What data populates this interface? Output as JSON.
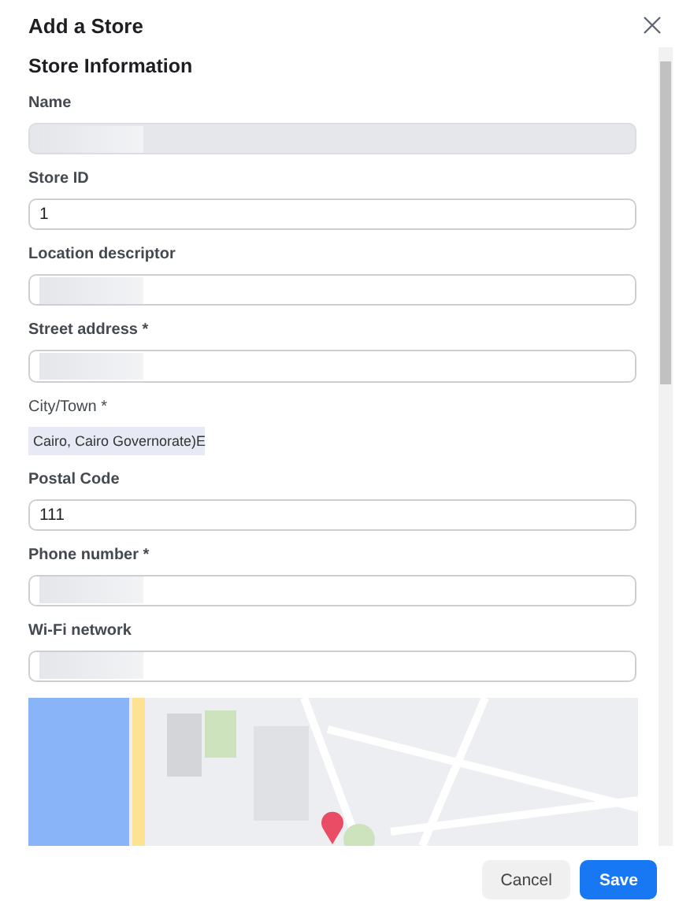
{
  "dialog": {
    "title": "Add a Store"
  },
  "section": {
    "title": "Store Information"
  },
  "fields": [
    {
      "kind": "text",
      "label": "Name",
      "disabled": true
    },
    {
      "kind": "text",
      "label": "Store ID",
      "disabled": false,
      "value": "1"
    },
    {
      "kind": "text",
      "label": "Location descriptor",
      "disabled": false
    },
    {
      "kind": "text",
      "label": "Street address *",
      "disabled": false
    },
    {
      "kind": "chip",
      "label": "City/Town *",
      "value": "Cairo, Cairo Governorate)E"
    },
    {
      "kind": "text",
      "label": "Postal Code",
      "disabled": false,
      "value": "111"
    },
    {
      "kind": "text",
      "label": "Phone number *",
      "disabled": false
    },
    {
      "kind": "text",
      "label": "Wi-Fi network",
      "disabled": false
    }
  ],
  "buttons": [
    {
      "label": "Cancel",
      "kind": "secondary"
    },
    {
      "label": "Save",
      "kind": "primary"
    }
  ]
}
